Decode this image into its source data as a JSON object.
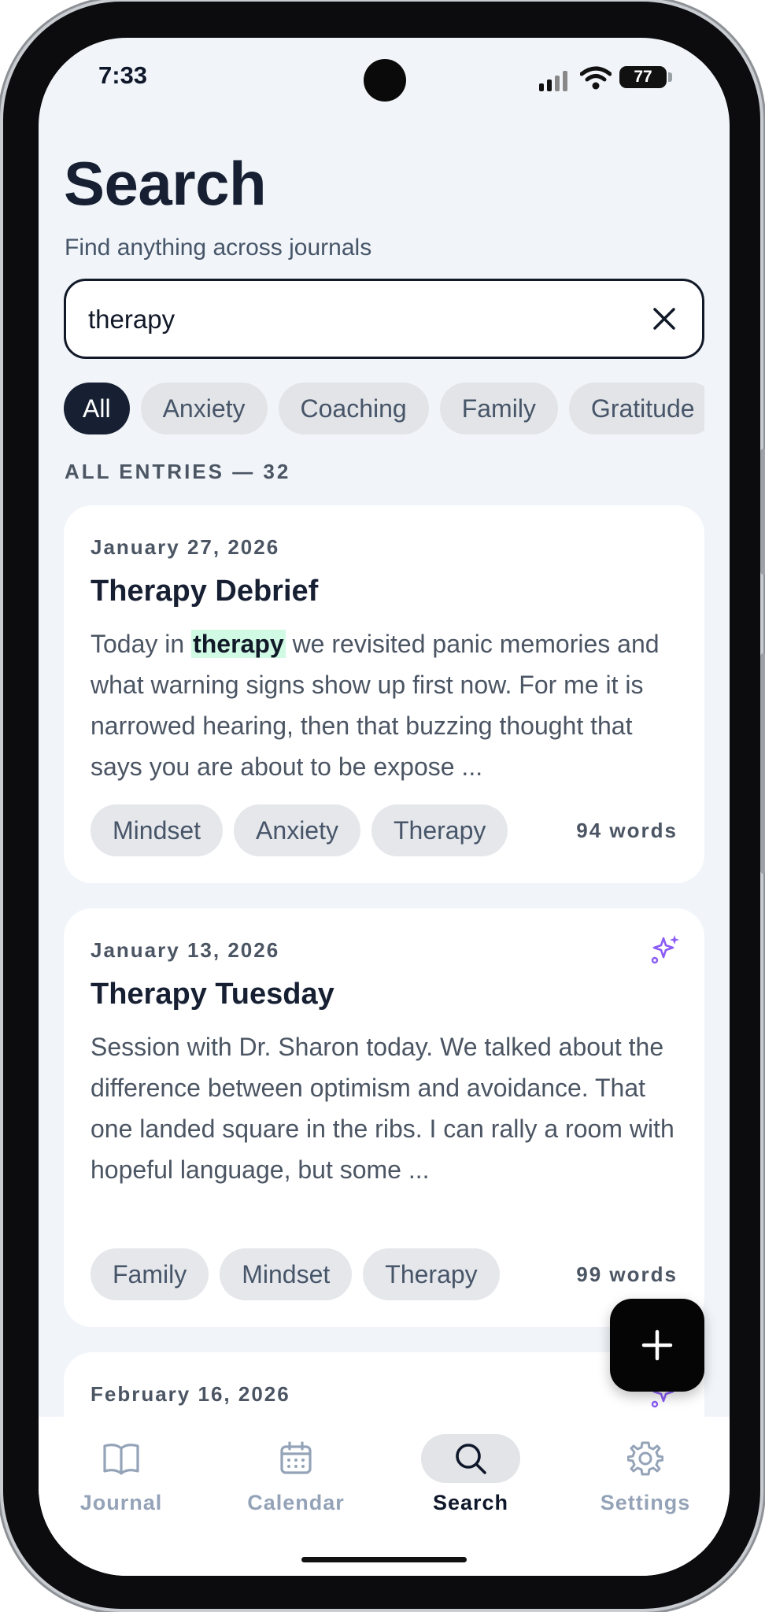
{
  "status_bar": {
    "time": "7:33",
    "battery": "77"
  },
  "header": {
    "title": "Search",
    "subtitle": "Find anything across journals"
  },
  "search": {
    "value": "therapy"
  },
  "filters": [
    "All",
    "Anxiety",
    "Coaching",
    "Family",
    "Gratitude"
  ],
  "section_label": "ALL ENTRIES — 32",
  "entries": [
    {
      "date": "January 27, 2026",
      "title": "Therapy Debrief",
      "excerpt_before": "Today in ",
      "excerpt_match": "therapy",
      "excerpt_after": " we revisited panic memories and what warning signs show up first now. For me it is narrowed hearing, then that buzzing thought that says you are about to be expose ...",
      "tags": [
        "Mindset",
        "Anxiety",
        "Therapy"
      ],
      "word_count": "94 words"
    },
    {
      "date": "January 13, 2026",
      "title": "Therapy Tuesday",
      "excerpt": "Session with Dr. Sharon today. We talked about the difference between optimism and avoidance. That one landed square in the ribs. I can rally a room with hopeful language, but some ...",
      "tags": [
        "Family",
        "Mindset",
        "Therapy"
      ],
      "word_count": "99 words",
      "icon": "sparkles-icon"
    },
    {
      "date": "February 16, 2026",
      "icon": "sparkles-icon"
    }
  ],
  "tabs": [
    {
      "label": "Journal",
      "icon": "book-icon"
    },
    {
      "label": "Calendar",
      "icon": "calendar-icon"
    },
    {
      "label": "Search",
      "icon": "search-icon",
      "active": true
    },
    {
      "label": "Settings",
      "icon": "gear-icon"
    }
  ],
  "colors": {
    "accent": "#172033",
    "highlight": "#d1fae5",
    "sparkle": "#8b5cf6"
  }
}
